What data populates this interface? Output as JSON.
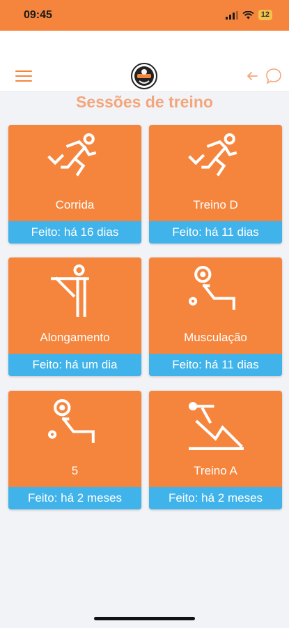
{
  "status_bar": {
    "time": "09:45",
    "battery": "12",
    "icons": [
      "signal-icon",
      "wifi-icon",
      "battery-icon"
    ]
  },
  "header": {
    "menu_icon": "hamburger-icon",
    "logo": "club-logo",
    "back_icon": "arrow-left-icon",
    "chat_icon": "chat-bubble-icon"
  },
  "page": {
    "title": "Sessões de treino"
  },
  "sessions": [
    {
      "name": "Corrida",
      "status": "Feito: há 16 dias",
      "icon": "running-icon"
    },
    {
      "name": "Treino D",
      "status": "Feito: há 11 dias",
      "icon": "running-icon"
    },
    {
      "name": "Alongamento",
      "status": "Feito: há um dia",
      "icon": "stretching-icon"
    },
    {
      "name": "Musculação",
      "status": "Feito: há 11 dias",
      "icon": "weightlifting-icon"
    },
    {
      "name": "5",
      "status": "Feito: há 2 meses",
      "icon": "weightlifting-icon"
    },
    {
      "name": "Treino A",
      "status": "Feito: há 2 meses",
      "icon": "bench-press-icon"
    }
  ],
  "colors": {
    "accent": "#f5853d",
    "footer": "#3fb3ea",
    "title": "#f5a57a",
    "background": "#f2f3f7"
  }
}
